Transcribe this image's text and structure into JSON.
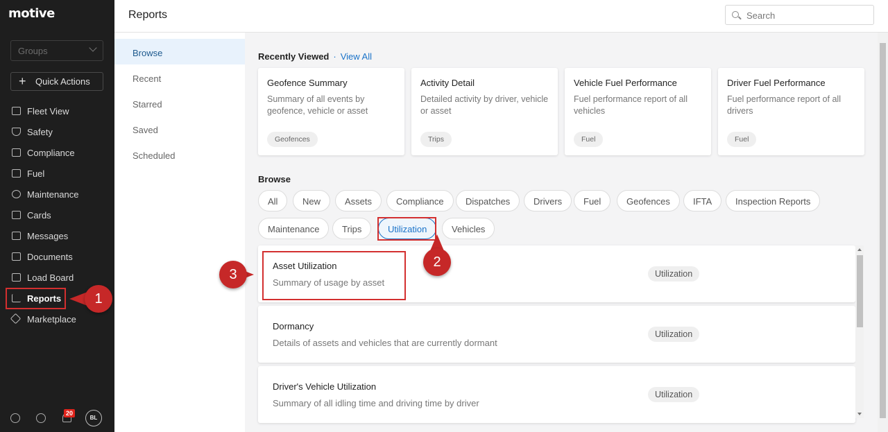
{
  "app": {
    "logo": "motive"
  },
  "sidebar": {
    "groups_placeholder": "Groups",
    "quick_actions": "Quick Actions",
    "items": [
      {
        "label": "Fleet View",
        "icon": "map-icon"
      },
      {
        "label": "Safety",
        "icon": "shield-icon"
      },
      {
        "label": "Compliance",
        "icon": "document-icon"
      },
      {
        "label": "Fuel",
        "icon": "fuel-icon"
      },
      {
        "label": "Maintenance",
        "icon": "wrench-icon"
      },
      {
        "label": "Cards",
        "icon": "card-icon"
      },
      {
        "label": "Messages",
        "icon": "chat-icon"
      },
      {
        "label": "Documents",
        "icon": "file-icon"
      },
      {
        "label": "Load Board",
        "icon": "truck-icon"
      },
      {
        "label": "Reports",
        "icon": "chart-icon",
        "active": true
      },
      {
        "label": "Marketplace",
        "icon": "layers-icon"
      }
    ],
    "notification_count": "20",
    "avatar_initials": "BL"
  },
  "header": {
    "title": "Reports",
    "search_placeholder": "Search"
  },
  "subnav": {
    "items": [
      "Browse",
      "Recent",
      "Starred",
      "Saved",
      "Scheduled"
    ],
    "active": "Browse"
  },
  "recently_viewed": {
    "heading": "Recently Viewed",
    "view_all": "View All",
    "cards": [
      {
        "title": "Geofence Summary",
        "desc": "Summary of all events by geofence, vehicle or asset",
        "tag": "Geofences"
      },
      {
        "title": "Activity Detail",
        "desc": "Detailed activity by driver, vehicle or asset",
        "tag": "Trips"
      },
      {
        "title": "Vehicle Fuel Performance",
        "desc": "Fuel performance report of all vehicles",
        "tag": "Fuel"
      },
      {
        "title": "Driver Fuel Performance",
        "desc": "Fuel performance report of all drivers",
        "tag": "Fuel"
      }
    ]
  },
  "browse": {
    "heading": "Browse",
    "filters": [
      "All",
      "New",
      "Assets",
      "Compliance",
      "Dispatches",
      "Drivers",
      "Fuel",
      "Geofences",
      "IFTA",
      "Inspection Reports",
      "Maintenance",
      "Trips",
      "Utilization",
      "Vehicles"
    ],
    "active_filter": "Utilization",
    "reports": [
      {
        "title": "Asset Utilization",
        "desc": "Summary of usage by asset",
        "tag": "Utilization"
      },
      {
        "title": "Dormancy",
        "desc": "Details of assets and vehicles that are currently dormant",
        "tag": "Utilization"
      },
      {
        "title": "Driver's Vehicle Utilization",
        "desc": "Summary of all idling time and driving time by driver",
        "tag": "Utilization"
      }
    ]
  },
  "callouts": [
    "1",
    "2",
    "3"
  ],
  "colors": {
    "sidebar_bg": "#1e1e1e",
    "accent": "#1a73c9",
    "callout": "#c62828"
  }
}
